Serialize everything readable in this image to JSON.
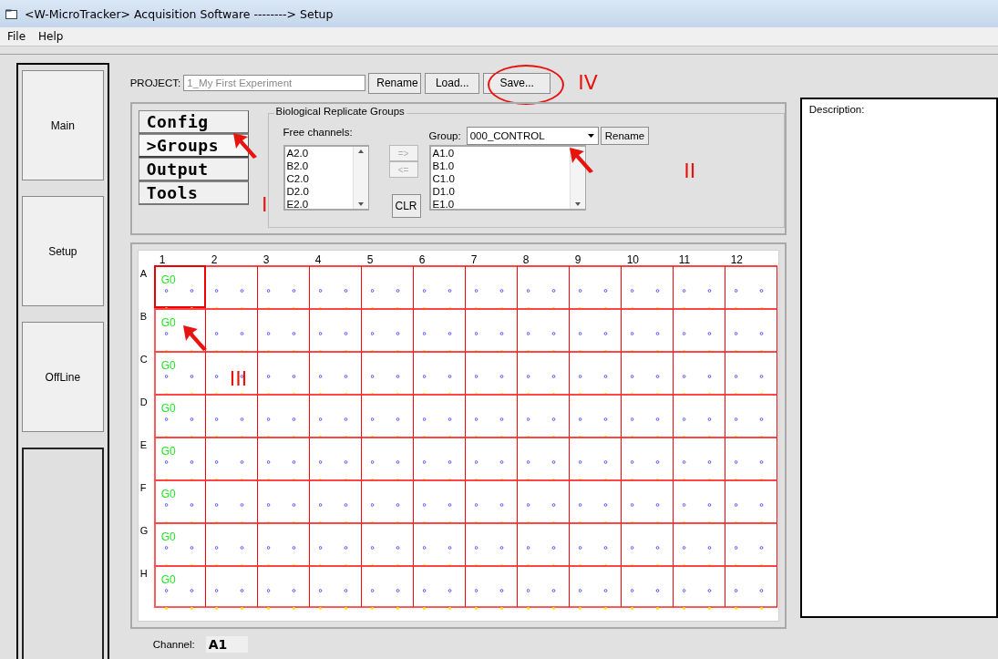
{
  "window": {
    "title": "<W-MicroTracker> Acquisition Software  --------> Setup"
  },
  "menu": [
    "File",
    "Help"
  ],
  "sidebar": {
    "items": [
      {
        "label": "Main"
      },
      {
        "label": "Setup"
      },
      {
        "label": "OffLine"
      }
    ]
  },
  "project": {
    "label": "PROJECT:",
    "placeholder": "1_My First Experiment",
    "buttons": [
      "Rename",
      "Load...",
      "Save..."
    ],
    "marker": "IV"
  },
  "config_tabs": [
    {
      "label": "Config",
      "selected": false
    },
    {
      "label": ">Groups",
      "selected": true
    },
    {
      "label": "Output",
      "selected": false
    },
    {
      "label": "Tools",
      "selected": false
    }
  ],
  "groups": {
    "title": "Biological Replicate Groups",
    "free_label": "Free channels:",
    "free_channels": [
      "A2.0",
      "B2.0",
      "C2.0",
      "D2.0",
      "E2.0"
    ],
    "move_buttons": [
      {
        "label": "=>",
        "disabled": true
      },
      {
        "label": "<=",
        "disabled": true
      }
    ],
    "clear_button": "CLR",
    "group_label": "Group:",
    "group_value": "000_CONTROL",
    "rename_button": "Rename",
    "group_channels": [
      "A1.0",
      "B1.0",
      "C1.0",
      "D1.0",
      "E1.0"
    ],
    "marker_tabs": "I",
    "marker_group": "II"
  },
  "plate": {
    "columns": [
      "1",
      "2",
      "3",
      "4",
      "5",
      "6",
      "7",
      "8",
      "9",
      "10",
      "11",
      "12"
    ],
    "marker": "III",
    "rows": [
      {
        "label": "A",
        "cells": [
          {
            "text": "G0",
            "selected": true
          },
          {
            "selected": false
          },
          {
            "selected": false
          },
          {
            "selected": false
          },
          {
            "selected": false
          },
          {
            "selected": false
          },
          {
            "selected": false
          },
          {
            "selected": false
          },
          {
            "selected": false
          },
          {
            "selected": false
          },
          {
            "selected": false
          },
          {
            "selected": false
          }
        ]
      },
      {
        "label": "B",
        "cells": [
          {
            "text": "G0",
            "selected": false
          },
          {
            "selected": false
          },
          {
            "selected": false
          },
          {
            "selected": false
          },
          {
            "selected": false
          },
          {
            "selected": false
          },
          {
            "selected": false
          },
          {
            "selected": false
          },
          {
            "selected": false
          },
          {
            "selected": false
          },
          {
            "selected": false
          },
          {
            "selected": false
          }
        ]
      },
      {
        "label": "C",
        "cells": [
          {
            "text": "G0",
            "selected": false
          },
          {
            "selected": false
          },
          {
            "selected": false
          },
          {
            "selected": false
          },
          {
            "selected": false
          },
          {
            "selected": false
          },
          {
            "selected": false
          },
          {
            "selected": false
          },
          {
            "selected": false
          },
          {
            "selected": false
          },
          {
            "selected": false
          },
          {
            "selected": false
          }
        ]
      },
      {
        "label": "D",
        "cells": [
          {
            "text": "G0",
            "selected": false
          },
          {
            "selected": false
          },
          {
            "selected": false
          },
          {
            "selected": false
          },
          {
            "selected": false
          },
          {
            "selected": false
          },
          {
            "selected": false
          },
          {
            "selected": false
          },
          {
            "selected": false
          },
          {
            "selected": false
          },
          {
            "selected": false
          },
          {
            "selected": false
          }
        ]
      },
      {
        "label": "E",
        "cells": [
          {
            "text": "G0",
            "selected": false
          },
          {
            "selected": false
          },
          {
            "selected": false
          },
          {
            "selected": false
          },
          {
            "selected": false
          },
          {
            "selected": false
          },
          {
            "selected": false
          },
          {
            "selected": false
          },
          {
            "selected": false
          },
          {
            "selected": false
          },
          {
            "selected": false
          },
          {
            "selected": false
          }
        ]
      },
      {
        "label": "F",
        "cells": [
          {
            "text": "G0",
            "selected": false
          },
          {
            "selected": false
          },
          {
            "selected": false
          },
          {
            "selected": false
          },
          {
            "selected": false
          },
          {
            "selected": false
          },
          {
            "selected": false
          },
          {
            "selected": false
          },
          {
            "selected": false
          },
          {
            "selected": false
          },
          {
            "selected": false
          },
          {
            "selected": false
          }
        ]
      },
      {
        "label": "G",
        "cells": [
          {
            "text": "G0",
            "selected": false
          },
          {
            "selected": false
          },
          {
            "selected": false
          },
          {
            "selected": false
          },
          {
            "selected": false
          },
          {
            "selected": false
          },
          {
            "selected": false
          },
          {
            "selected": false
          },
          {
            "selected": false
          },
          {
            "selected": false
          },
          {
            "selected": false
          },
          {
            "selected": false
          }
        ]
      },
      {
        "label": "H",
        "cells": [
          {
            "text": "G0",
            "selected": false
          },
          {
            "selected": false
          },
          {
            "selected": false
          },
          {
            "selected": false
          },
          {
            "selected": false
          },
          {
            "selected": false
          },
          {
            "selected": false
          },
          {
            "selected": false
          },
          {
            "selected": false
          },
          {
            "selected": false
          },
          {
            "selected": false
          },
          {
            "selected": false
          }
        ]
      }
    ]
  },
  "channel": {
    "label": "Channel:",
    "value": "A1"
  },
  "description": {
    "label": "Description:"
  }
}
